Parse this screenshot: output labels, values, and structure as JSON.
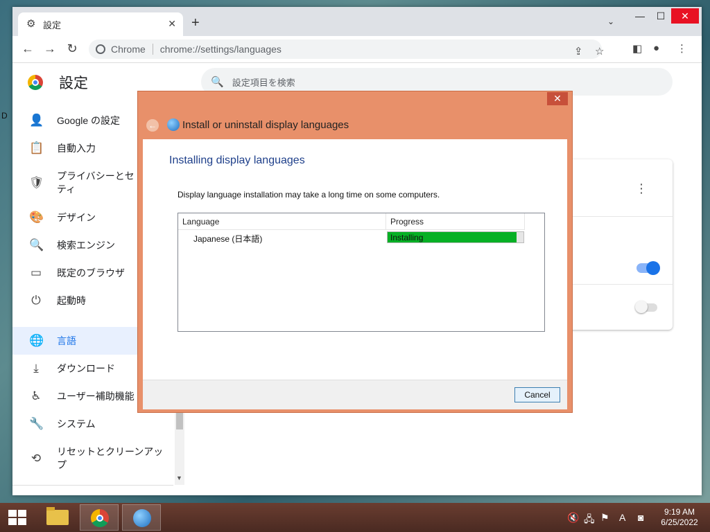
{
  "desktop": {
    "left_text": "D"
  },
  "browser": {
    "tab_title": "設定",
    "site_label": "Chrome",
    "url": "chrome://settings/languages"
  },
  "settings": {
    "title": "設定",
    "search_placeholder": "設定項目を検索",
    "sidebar": [
      {
        "label": "Google の設定",
        "icon": "person-icon"
      },
      {
        "label": "自動入力",
        "icon": "clipboard-icon"
      },
      {
        "label": "プライバシーとセ\nティ",
        "icon": "shield-icon"
      },
      {
        "label": "デザイン",
        "icon": "palette-icon"
      },
      {
        "label": "検索エンジン",
        "icon": "search-icon"
      },
      {
        "label": "既定のブラウザ",
        "icon": "browser-icon"
      },
      {
        "label": "起動時",
        "icon": "power-icon"
      },
      {
        "label": "言語",
        "icon": "globe-icon",
        "active": true
      },
      {
        "label": "ダウンロード",
        "icon": "download-icon"
      },
      {
        "label": "ユーザー補助機能",
        "icon": "accessibility-icon"
      },
      {
        "label": "システム",
        "icon": "wrench-icon"
      },
      {
        "label": "リセットとクリーンアッ\nプ",
        "icon": "history-icon"
      }
    ]
  },
  "dialog": {
    "title": "Install or uninstall display languages",
    "heading": "Installing display languages",
    "description": "Display language installation may take a long time on some computers.",
    "columns": {
      "language": "Language",
      "progress": "Progress"
    },
    "rows": [
      {
        "language": "Japanese (日本語)",
        "status": "Installing",
        "progress": 0.95
      }
    ],
    "cancel_label": "Cancel",
    "progress_color": "#06b025"
  },
  "taskbar": {
    "time": "9:19 AM",
    "date": "6/25/2022",
    "ime_label": "A"
  }
}
